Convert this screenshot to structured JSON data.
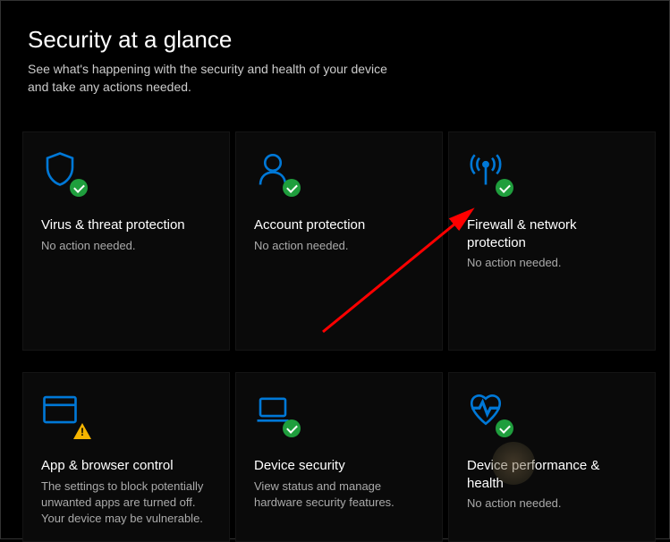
{
  "header": {
    "title": "Security at a glance",
    "subtitle": "See what's happening with the security and health of your device and take any actions needed."
  },
  "tiles": [
    {
      "id": "virus",
      "title": "Virus & threat protection",
      "desc": "No action needed.",
      "status": "ok"
    },
    {
      "id": "account",
      "title": "Account protection",
      "desc": "No action needed.",
      "status": "ok"
    },
    {
      "id": "firewall",
      "title": "Firewall & network protection",
      "desc": "No action needed.",
      "status": "ok"
    },
    {
      "id": "app-browser",
      "title": "App & browser control",
      "desc": "The settings to block potentially unwanted apps are turned off. Your device may be vulnerable.",
      "status": "warn"
    },
    {
      "id": "device-security",
      "title": "Device security",
      "desc": "View status and manage hardware security features.",
      "status": "ok"
    },
    {
      "id": "device-performance",
      "title": "Device performance & health",
      "desc": "No action needed.",
      "status": "ok"
    }
  ]
}
